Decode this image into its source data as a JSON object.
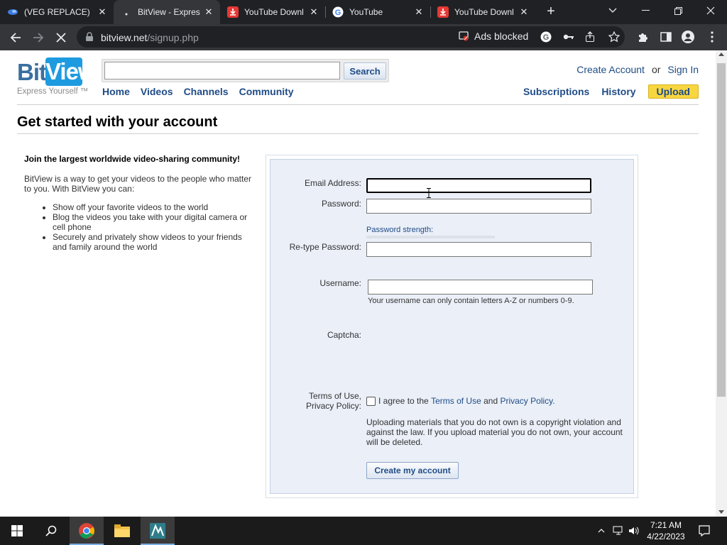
{
  "browser": {
    "tabs": [
      {
        "title": "(VEG REPLACE)[",
        "favicon": "edge-blue-icon"
      },
      {
        "title": "BitView - Expres",
        "favicon": "loading-dot-icon",
        "active": true
      },
      {
        "title": "YouTube Downl",
        "favicon": "download-red-icon"
      },
      {
        "title": "YouTube",
        "favicon": "google-g-icon"
      },
      {
        "title": "YouTube Downl",
        "favicon": "download-red-icon"
      }
    ],
    "url_host": "bitview.net",
    "url_path": "/signup.php",
    "ads_blocked_label": "Ads blocked"
  },
  "site": {
    "logo_bit": "Bit",
    "logo_view": "View",
    "tagline": "Express Yourself ™",
    "search_placeholder": "",
    "search_button": "Search",
    "nav": [
      "Home",
      "Videos",
      "Channels",
      "Community"
    ],
    "create_account": "Create Account",
    "or": "or",
    "sign_in": "Sign In",
    "subscriptions": "Subscriptions",
    "history": "History",
    "upload": "Upload"
  },
  "page": {
    "title": "Get started with your account",
    "promo_heading": "Join the largest worldwide video-sharing community!",
    "promo_intro": "BitView is a way to get your videos to the people who matter to you. With BitView you can:",
    "promo_items": [
      "Show off your favorite videos to the world",
      "Blog the videos you take with your digital camera or cell phone",
      "Securely and privately show videos to your friends and family around the world"
    ]
  },
  "form": {
    "email_label": "Email Address:",
    "email_value": "",
    "password_label": "Password:",
    "password_value": "",
    "strength_label": "Password strength:",
    "strength_level": 0,
    "retype_label": "Re-type Password:",
    "retype_value": "",
    "username_label": "Username:",
    "username_value": "",
    "username_hint": "Your username can only contain letters A-Z or numbers 0-9.",
    "captcha_label": "Captcha:",
    "terms_label_1": "Terms of Use,",
    "terms_label_2": "Privacy Policy:",
    "agree_prefix": "I agree to the",
    "terms_link": "Terms of Use",
    "and": "and",
    "privacy_link": "Privacy Policy.",
    "agree_checked": false,
    "legal_text": "Uploading materials that you do not own is a copyright violation and against the law. If you upload material you do not own, your account will be deleted.",
    "submit_label": "Create my account"
  },
  "taskbar": {
    "time": "7:21 AM",
    "date": "4/22/2023"
  }
}
